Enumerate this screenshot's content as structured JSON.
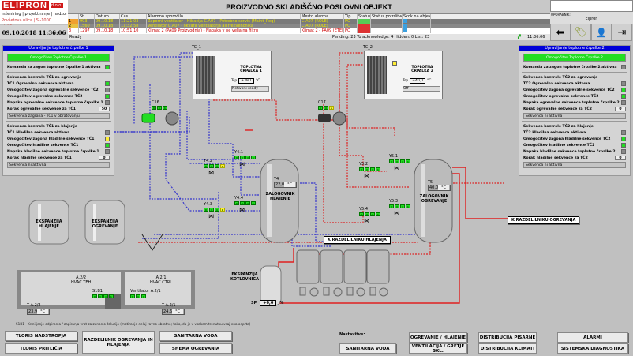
{
  "header": {
    "logo": "ELIPRON",
    "logo_suffix": "d.o.o.",
    "tagline": "inženiring | projektiranje | nadzor",
    "address": "Povšetova ulica | SI-1000 Ljubljana",
    "datetime": "09.10.2018   11:36:06",
    "title": "PROIZVODNO SKLADIŠČNO POSLOVNI OBJEKT"
  },
  "alarms": {
    "columns": [
      "",
      "Št.",
      "Datum",
      "Čas",
      "Alarmno sporočilo",
      "Mesto alarma",
      "Tip",
      "Status",
      "Status potrditve",
      "Skok na objekt"
    ],
    "rows": [
      {
        "idx": "1",
        "no": "993",
        "date": "09.10.18",
        "time": "11:21:03",
        "msg": "Zaporni ventilator - Hibacija C.A07 - Potrebno servis (Maint_Req)",
        "place": "C.A07 (ROLE)",
        "type": "PO"
      },
      {
        "idx": "2",
        "no": "1560",
        "date": "09.10.18",
        "time": "11:32:58",
        "msg": "Ventilator C.A07 - okvara ventilatorja ali frekvenčnika",
        "place": "C.A07 (ROLE)",
        "type": "PO"
      },
      {
        "idx": "3",
        "no": "1297",
        "date": "09.10.18",
        "time": "10:51:10",
        "msg": "Klimat 2 (PA09 Proizvodnja) - Napaka v ne velja na filtru",
        "place": "Klimat 2 - PA09 (ETEH)",
        "type": "PO"
      }
    ],
    "status_line": "Ready",
    "counters": "Pending: 23   To acknowledge: 4   Hidden: 0   List: 23",
    "clock": "11:36:06"
  },
  "user": {
    "label": "UPORABNIK:",
    "name": "Elpron"
  },
  "toolbar_icons": [
    "back-arrow-icon",
    "tag-icon",
    "user-settings-icon",
    "logout-icon"
  ],
  "panel1": {
    "title": "Upravljanje toplotne črpalke 1",
    "enable_button": "Omogočitev Toplotne Črpalke 1",
    "command": {
      "label": "Komanda za zagon toplotne črpalke 1 aktivna",
      "state": "green"
    },
    "heat_title": "Sekvenca kontrole TČ1 za ogrevanje",
    "heat_rows": [
      {
        "label": "TČ1 Ogrevalna sekvenca aktivna",
        "state": "green"
      },
      {
        "label": "Omogočitev zagona ogrevalne sekvence TČ2",
        "state": "gray"
      },
      {
        "label": "Omogočitev ogrevalne sekvence TČ2",
        "state": "green"
      },
      {
        "label": "Napaka ogrevalne sekvence toplotne črpalke 1",
        "state": "gray"
      }
    ],
    "heat_step_label": "Korak ogrevalne sekvence za TČ1",
    "heat_step": "50",
    "heat_status": "Sekvenca zagrana - TČ1 v obratovanju",
    "cool_title": "Sekvenca kontrole TČ1 za hlajenje",
    "cool_rows": [
      {
        "label": "TČ1 Hladilna sekvenca aktivna",
        "state": "gray"
      },
      {
        "label": "Omogočitev zagona hladilne sekvence TČ1",
        "state": "yellow"
      },
      {
        "label": "Omogočitev hladilne sekvence TČ1",
        "state": "green"
      },
      {
        "label": "Napaka hladilne sekvence toplotne črpalke 1",
        "state": "gray"
      }
    ],
    "cool_step_label": "Korak hladilne sekvence za TČ1",
    "cool_step": "0",
    "cool_status": "Sekvenca ni aktivna"
  },
  "panel2": {
    "title": "Upravljanje toplotne črpalke 2",
    "enable_button": "Omogočitev Toplotne Črpalke 2",
    "command": {
      "label": "Komanda za zagon toplotne črpalke 2 aktivna",
      "state": "gray"
    },
    "heat_title": "Sekvenca kontrole TČ2 za ogrevanje",
    "heat_rows": [
      {
        "label": "TČ2 Ogrevalna sekvenca aktivna",
        "state": "gray"
      },
      {
        "label": "Omogočitev zagona ogrevalne sekvence TČ2",
        "state": "green"
      },
      {
        "label": "Omogočitev ogrevalne sekvence TČ2",
        "state": "green"
      },
      {
        "label": "Napaka ogrevalne sekvence toplotne črpalke 2",
        "state": "gray"
      }
    ],
    "heat_step_label": "Korak ogrevalne sekvence za TČ2",
    "heat_step": "0",
    "heat_status": "Sekvenca ni aktivna",
    "cool_title": "Sekvenca kontrole TČ2 za hlajenje",
    "cool_rows": [
      {
        "label": "TČ2 Hladilna sekvenca aktivna",
        "state": "gray"
      },
      {
        "label": "Omogočitev zagona hladilne sekvence TČ2",
        "state": "green"
      },
      {
        "label": "Omogočitev hladilne sekvence TČ2",
        "state": "green"
      },
      {
        "label": "Napaka hladilne sekvence toplotne črpalke 2",
        "state": "gray"
      }
    ],
    "cool_step_label": "Korak hladilne sekvence za TČ2",
    "cool_step": "0",
    "cool_status": "Sekvenca ni aktivna"
  },
  "tc1": {
    "tag": "TC_1",
    "name": "TOPLOTNA ČRPALKA 1",
    "tsp_label": "Tsp",
    "tsp": "+39,1",
    "unit": "°C",
    "status": "Network ready"
  },
  "tc2": {
    "tag": "TC_2",
    "name": "TOPLOTNA ČRPALKA 2",
    "tsp_label": "Tsp",
    "tsp": "+40,0",
    "unit": "°C",
    "status": "Off"
  },
  "pumps": {
    "c16": "C16",
    "c17": "C17"
  },
  "valves": {
    "y41": "Y4.1",
    "y42": "Y4.2",
    "y43": "Y4.3",
    "y44": "Y4.4",
    "y51": "Y5.1",
    "y52": "Y5.2",
    "y53": "Y5.3",
    "y54": "Y5.4"
  },
  "status_letters": [
    "D",
    "0",
    "A",
    "b"
  ],
  "tanks": {
    "t4": {
      "tag": "T4",
      "value": "22,0",
      "unit": "°C",
      "name": "ZALOGOVNIK HLAJENJE"
    },
    "t5": {
      "tag": "T5",
      "value": "40,0",
      "unit": "°C",
      "name": "ZALOGOVNIK OGREVANJE"
    },
    "exp_cool": "EKSPANZIJA HLAJENJE",
    "exp_heat": "EKSPANZIJA OGREVANJE",
    "exp_boiler": "EKSPANZIJA KOTLOVNICA",
    "sp_label": "SP",
    "sp_value": "+0,0",
    "sp_unit": "%"
  },
  "links": {
    "to_cool": "K RAZDELILNIKU HLAJENJA",
    "to_heat": "K RAZDELILNIKU OGREVANJA"
  },
  "rooms": {
    "a22": {
      "name": "A.2/2",
      "sub": "HVAC TEH",
      "sensor": "T A.2/2",
      "value": "23,9",
      "unit": "°C",
      "device": "S1B1"
    },
    "a21": {
      "name": "A.2/1",
      "sub": "HVAC CTRL",
      "sensor": "T A.2/1",
      "value": "24,6",
      "unit": "°C",
      "fan": "Ventilator A.2/1"
    },
    "note": "S1B1 - Krmiljenje odpiranja / zapiranja vrat za zunanjo žaluzijo (motiranje deluj ravno obratno; tako, da je v vsakem trenutku vsaj ena odprta)"
  },
  "nav": {
    "tloris_nadstropja": "TLORIS NADSTROPJA",
    "tloris_pritlicja": "TLORIS PRITLIČJA",
    "razdelilnik": "RAZDELILNIK OGREVANJA IN HLAJENJA",
    "sanitarna_voda": "SANITARNA VODA",
    "shema_ogrevanja": "SHEMA OGREVANJA",
    "nastavitve": "Nastavitve:",
    "set_sanitarna": "SANITARNA VODA",
    "ogrevanje_hlajenje": "OGREVANJE / HLAJENJE",
    "ventilacija": "VENTILACIJA / GRETJE SKL.",
    "distribucija_pisarne": "DISTRIBUCIJA PISARNE",
    "distribucija_klimati": "DISTRIBUCIJA KLIMATI",
    "alarmi": "ALARMI",
    "diagnostika": "SISTEMSKA DIAGNOSTIKA"
  },
  "colors": {
    "cold_pipe": "#3333cc",
    "hot_pipe": "#dd2222",
    "ok": "#22dd22",
    "warn": "#ffee33",
    "panel_header": "#0000d8"
  }
}
